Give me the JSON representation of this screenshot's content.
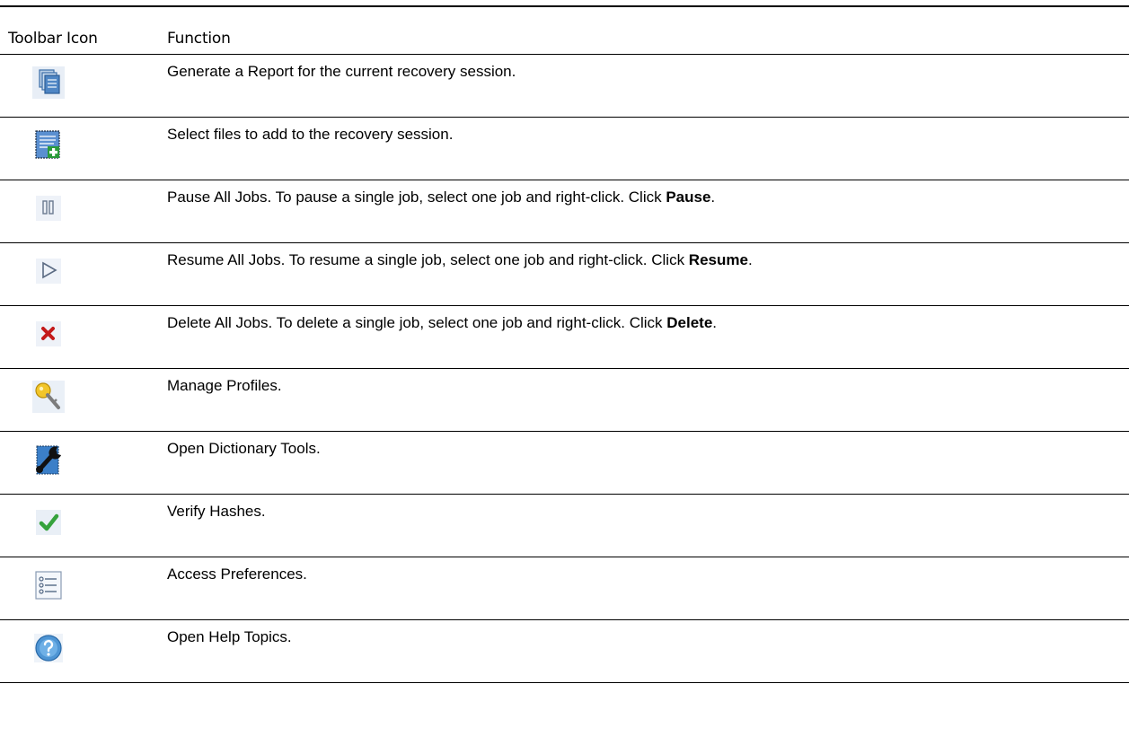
{
  "header": {
    "icon_col": "Toolbar Icon",
    "function_col": "Function"
  },
  "rows": [
    {
      "icon": "generate-report-icon",
      "text": "Generate a Report for the current recovery session.",
      "bold": "",
      "tail": ""
    },
    {
      "icon": "add-files-icon",
      "text": "Select files to add to the recovery session.",
      "bold": "",
      "tail": ""
    },
    {
      "icon": "pause-all-icon",
      "text": "Pause All Jobs. To pause a single job, select one job and right-click. Click ",
      "bold": "Pause",
      "tail": "."
    },
    {
      "icon": "resume-all-icon",
      "text": "Resume All Jobs. To resume a single job, select one job and right-click. Click ",
      "bold": "Resume",
      "tail": "."
    },
    {
      "icon": "delete-all-icon",
      "text": "Delete All Jobs. To delete a single job, select one job and right-click. Click ",
      "bold": "Delete",
      "tail": "."
    },
    {
      "icon": "manage-profiles-key-icon",
      "text": "Manage Profiles.",
      "bold": "",
      "tail": ""
    },
    {
      "icon": "dictionary-tools-wrench-icon",
      "text": "Open Dictionary Tools.",
      "bold": "",
      "tail": ""
    },
    {
      "icon": "verify-hashes-check-icon",
      "text": "Verify Hashes.",
      "bold": "",
      "tail": ""
    },
    {
      "icon": "preferences-list-icon",
      "text": "Access Preferences.",
      "bold": "",
      "tail": ""
    },
    {
      "icon": "help-question-icon",
      "text": "Open Help Topics.",
      "bold": "",
      "tail": ""
    }
  ]
}
